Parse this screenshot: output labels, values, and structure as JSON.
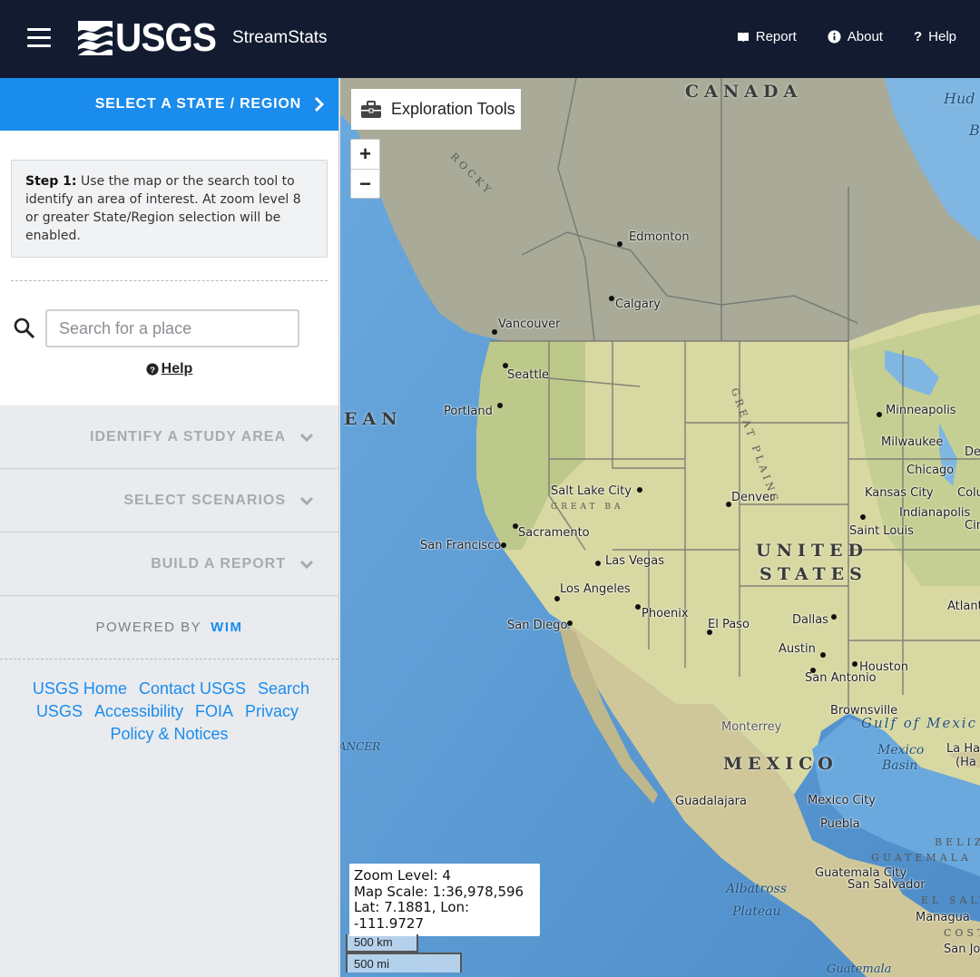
{
  "header": {
    "logo_text": "USGS",
    "app_title": "StreamStats",
    "nav": [
      {
        "label": "Report",
        "icon": "book-icon"
      },
      {
        "label": "About",
        "icon": "info-circle-icon"
      },
      {
        "label": "Help",
        "icon": "question-icon"
      }
    ]
  },
  "sidebar": {
    "step_header": "SELECT A STATE / REGION",
    "step1": {
      "bold": "Step 1:",
      "text": " Use the map or the search tool to identify an area of interest. At zoom level 8 or greater State/Region selection will be enabled."
    },
    "search": {
      "placeholder": "Search for a place",
      "value": ""
    },
    "help_label": "Help",
    "sections": [
      {
        "label": "IDENTIFY A STUDY AREA"
      },
      {
        "label": "SELECT SCENARIOS"
      },
      {
        "label": "BUILD A REPORT"
      }
    ],
    "powered_by": "POWERED BY",
    "powered_org": "WIM",
    "footer_links": [
      "USGS Home",
      "Contact USGS",
      "Search USGS",
      "Accessibility",
      "FOIA",
      "Privacy",
      "Policy & Notices"
    ]
  },
  "map": {
    "exploration_tools": "Exploration Tools",
    "zoom_in": "+",
    "zoom_out": "−",
    "zoom_level": "Zoom Level: 4",
    "map_scale": "Map Scale: 1:36,978,596",
    "lat_lon": "Lat: 7.1881, Lon: -111.9727",
    "scale_km": "500 km",
    "scale_mi": "500 mi",
    "labels": {
      "canada": "CANADA",
      "united": "UNITED",
      "states": "STATES",
      "mexico": "MEXICO",
      "ean": "EAN",
      "ancer": "ANCER",
      "hud": "Hud",
      "b": "B",
      "edmonton": "Edmonton",
      "calgary": "Calgary",
      "vancouver": "Vancouver",
      "seattle": "Seattle",
      "portland": "Portland",
      "salt_lake_city": "Salt Lake City",
      "sacramento": "Sacramento",
      "san_francisco": "San Francisco",
      "las_vegas": "Las Vegas",
      "los_angeles": "Los Angeles",
      "phoenix": "Phoenix",
      "san_diego": "San Diego",
      "denver": "Denver",
      "el_paso": "El Paso",
      "dallas": "Dallas",
      "austin": "Austin",
      "san_antonio": "San Antonio",
      "houston": "Houston",
      "brownsville": "Brownsville",
      "monterrey": "Monterrey",
      "minneapolis": "Minneapolis",
      "milwaukee": "Milwaukee",
      "chicago": "Chicago",
      "kansas_city": "Kansas City",
      "saint_louis": "Saint Louis",
      "indianapolis": "Indianapolis",
      "columbus": "Colum",
      "cincinnati": "Cin",
      "detroit": "De",
      "atlanta": "Atlant",
      "guadalajara": "Guadalajara",
      "mexico_city": "Mexico City",
      "puebla": "Puebla",
      "guatemala": "GUATEMALA",
      "guatemala_city": "Guatemala City",
      "san_salvador": "San Salvador",
      "el_salvador": "EL SALV",
      "managua": "Managua",
      "costa": "COSTA",
      "san_jose": "San Jo",
      "belize": "BELIZE",
      "la_habana": "La Ha",
      "la_habana2": "(Ha",
      "gulf_of_mexico": "Gulf of Mexic",
      "mexico_basin": "Mexico",
      "mexico_basin2": "Basin",
      "albatross": "Albatross",
      "plateau": "Plateau",
      "great_plains": "GREAT PLAINS",
      "rocky": "ROCKY",
      "guatemala_bottom": "Guatemala",
      "great_basin": "GREAT BA"
    }
  }
}
